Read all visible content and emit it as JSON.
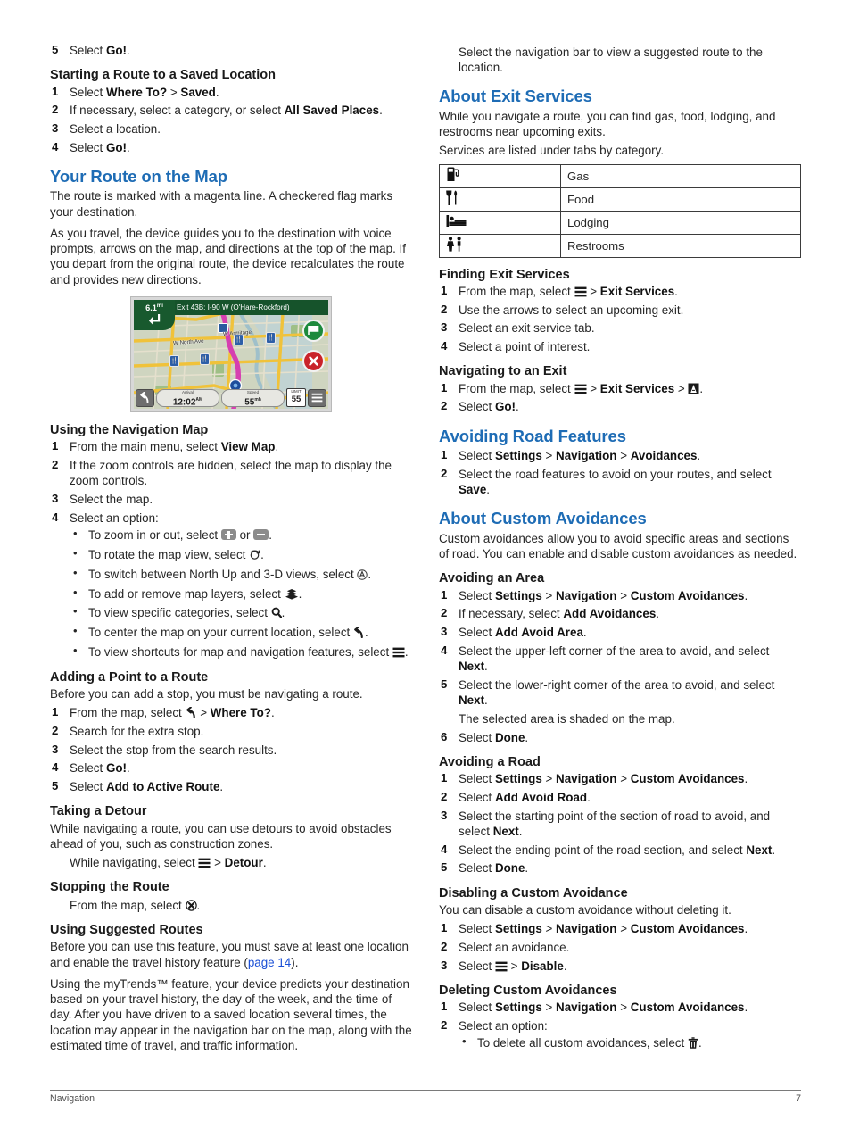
{
  "document": {
    "footer_section": "Navigation",
    "page_number": "7",
    "heading_color": "#1e6cb5",
    "link_color": "#1a4fd6"
  },
  "left_column": {
    "orphan_step": {
      "number": "5",
      "text_prefix": "Select ",
      "bold": "Go!",
      "text_suffix": "."
    },
    "starting_route_saved": {
      "heading": "Starting a Route to a Saved Location",
      "steps": [
        {
          "pre": "Select ",
          "b1": "Where To?",
          "mid": " > ",
          "b2": "Saved",
          "post": "."
        },
        {
          "pre": "If necessary, select a category, or select ",
          "b1": "All Saved Places",
          "post": "."
        },
        {
          "pre": "Select a location.",
          "post": ""
        },
        {
          "pre": "Select ",
          "b1": "Go!",
          "post": "."
        }
      ]
    },
    "your_route": {
      "heading": "Your Route on the Map",
      "para1": "The route is marked with a magenta line. A checkered flag marks your destination.",
      "para2": "As you travel, the device guides you to the destination with voice prompts, arrows on the map, and directions at the top of the map. If you depart from the original route, the device recalculates the route and provides new directions."
    },
    "map_figure": {
      "turn_distance": "6.1",
      "turn_distance_unit": "mi",
      "turn_arrow_icon": "turn-left-arrow-icon",
      "banner_text": "Exit 43B: I-90 W (O'Hare-Rockford)",
      "back_icon": "back-arrow-icon",
      "arrival_label": "Arrival",
      "arrival_value": "12:02",
      "arrival_suffix": "AM",
      "speed_label": "Speed",
      "speed_value": "55",
      "speed_suffix": "mh",
      "speed_limit_label": "LIMIT",
      "speed_limit_value": "55",
      "menu_icon": "hamburger-menu-icon",
      "go_button_icon": "go-flag-icon",
      "stop_button_icon": "stop-x-icon",
      "street_labels": [
        "W North Ave",
        "W Armitage",
        "I-90"
      ],
      "poi_icon": "restaurant-fork-knife-icon"
    },
    "using_nav_map": {
      "heading": "Using the Navigation Map",
      "steps": [
        {
          "pre": "From the main menu, select ",
          "b1": "View Map",
          "post": "."
        },
        {
          "pre": "If the zoom controls are hidden, select the map to display the zoom controls.",
          "post": ""
        },
        {
          "pre": "Select the map.",
          "post": ""
        },
        {
          "pre": "Select an option:",
          "post": ""
        }
      ],
      "options": [
        {
          "pre": "To zoom in or out, select ",
          "icon1": "zoom-in-plus-icon",
          "mid": " or ",
          "icon2": "zoom-out-minus-icon",
          "post": "."
        },
        {
          "pre": "To rotate the map view, select ",
          "icon1": "rotate-map-icon",
          "post": "."
        },
        {
          "pre": "To switch between North Up and 3-D views, select ",
          "icon1": "north-up-3d-view-icon",
          "post": "."
        },
        {
          "pre": "To add or remove map layers, select ",
          "icon1": "map-layers-icon",
          "post": "."
        },
        {
          "pre": "To view specific categories, select ",
          "icon1": "search-magnifier-icon",
          "post": "."
        },
        {
          "pre": "To center the map on your current location, select ",
          "icon1": "back-arrow-icon",
          "post": "."
        },
        {
          "pre": "To view shortcuts for map and navigation features, select ",
          "icon1": "hamburger-menu-icon",
          "post": "."
        }
      ]
    },
    "adding_point": {
      "heading": "Adding a Point to a Route",
      "intro": "Before you can add a stop, you must be navigating a route.",
      "steps": [
        {
          "pre": "From the map, select ",
          "icon1": "back-arrow-icon",
          "mid": " > ",
          "b2": "Where To?",
          "post": "."
        },
        {
          "pre": "Search for the extra stop.",
          "post": ""
        },
        {
          "pre": "Select the stop from the search results.",
          "post": ""
        },
        {
          "pre": "Select ",
          "b1": "Go!",
          "post": "."
        },
        {
          "pre": "Select ",
          "b1": "Add to Active Route",
          "post": "."
        }
      ]
    },
    "taking_detour": {
      "heading": "Taking a Detour",
      "intro": "While navigating a route, you can use detours to avoid obstacles ahead of you, such as construction zones.",
      "note_pre": "While navigating, select ",
      "note_icon": "hamburger-menu-icon",
      "note_mid": " > ",
      "note_bold": "Detour",
      "note_post": "."
    },
    "stopping_route": {
      "heading": "Stopping the Route",
      "note_pre": "From the map, select ",
      "note_icon": "stop-x-icon",
      "note_post": "."
    },
    "suggested_routes": {
      "heading": "Using Suggested Routes",
      "para1_pre": "Before you can use this feature, you must save at least one location and enable the travel history feature (",
      "para1_link": "page 14",
      "para1_post": ").",
      "para2": "Using the myTrends™ feature, your device predicts your destination based on your travel history, the day of the week, and the time of day. After you have driven to a saved location several times, the location may appear in the navigation bar on the map, along with the estimated time of travel, and traffic information."
    }
  },
  "right_column": {
    "top_note": "Select the navigation bar to view a suggested route to the location.",
    "about_exit_services": {
      "heading": "About Exit Services",
      "para1": "While you navigate a route, you can find gas, food, lodging, and restrooms near upcoming exits.",
      "para2": "Services are listed under tabs by category.",
      "table": [
        {
          "icon": "gas-pump-icon",
          "label": "Gas"
        },
        {
          "icon": "fork-knife-icon",
          "label": "Food"
        },
        {
          "icon": "bed-lodging-icon",
          "label": "Lodging"
        },
        {
          "icon": "restrooms-icon",
          "label": "Restrooms"
        }
      ]
    },
    "finding_exit_services": {
      "heading": "Finding Exit Services",
      "steps": [
        {
          "pre": "From the map, select ",
          "icon1": "hamburger-menu-icon",
          "mid": " > ",
          "b2": "Exit Services",
          "post": "."
        },
        {
          "pre": "Use the arrows to select an upcoming exit.",
          "post": ""
        },
        {
          "pre": "Select an exit service tab.",
          "post": ""
        },
        {
          "pre": "Select a point of interest.",
          "post": ""
        }
      ]
    },
    "navigating_to_exit": {
      "heading": "Navigating to an Exit",
      "steps": [
        {
          "pre": "From the map, select ",
          "icon1": "hamburger-menu-icon",
          "mid": " > ",
          "b2": "Exit Services",
          "mid2": " > ",
          "icon2": "navigate-route-icon",
          "post": "."
        },
        {
          "pre": "Select ",
          "b1": "Go!",
          "post": "."
        }
      ]
    },
    "avoiding_road_features": {
      "heading": "Avoiding Road Features",
      "steps": [
        {
          "pre": "Select ",
          "b1": "Settings",
          "mid": " > ",
          "b2": "Navigation",
          "mid2": " > ",
          "b3": "Avoidances",
          "post": "."
        },
        {
          "pre": "Select the road features to avoid on your routes, and select ",
          "b1": "Save",
          "post": "."
        }
      ]
    },
    "about_custom_avoidances": {
      "heading": "About Custom Avoidances",
      "para1": "Custom avoidances allow you to avoid specific areas and sections of road. You can enable and disable custom avoidances as needed."
    },
    "avoiding_area": {
      "heading": "Avoiding an Area",
      "steps": [
        {
          "pre": "Select ",
          "b1": "Settings",
          "mid": " > ",
          "b2": "Navigation",
          "mid2": " > ",
          "b3": "Custom Avoidances",
          "post": "."
        },
        {
          "pre": "If necessary, select ",
          "b1": "Add Avoidances",
          "post": "."
        },
        {
          "pre": "Select ",
          "b1": "Add Avoid Area",
          "post": "."
        },
        {
          "pre": "Select the upper-left corner of the area to avoid, and select ",
          "b1": "Next",
          "post": "."
        },
        {
          "pre": "Select the lower-right corner of the area to avoid, and select ",
          "b1": "Next",
          "post": "."
        }
      ],
      "note_after_step5": "The selected area is shaded on the map.",
      "final_step": {
        "pre": "Select ",
        "b1": "Done",
        "post": "."
      }
    },
    "avoiding_road": {
      "heading": "Avoiding a Road",
      "steps": [
        {
          "pre": "Select ",
          "b1": "Settings",
          "mid": " > ",
          "b2": "Navigation",
          "mid2": " > ",
          "b3": "Custom Avoidances",
          "post": "."
        },
        {
          "pre": "Select ",
          "b1": "Add Avoid Road",
          "post": "."
        },
        {
          "pre": "Select the starting point of the section of road to avoid, and select ",
          "b1": "Next",
          "post": "."
        },
        {
          "pre": "Select the ending point of the road section, and select ",
          "b1": "Next",
          "post": "."
        },
        {
          "pre": "Select ",
          "b1": "Done",
          "post": "."
        }
      ]
    },
    "disabling_custom_avoidance": {
      "heading": "Disabling a Custom Avoidance",
      "intro": "You can disable a custom avoidance without deleting it.",
      "steps": [
        {
          "pre": "Select ",
          "b1": "Settings",
          "mid": " > ",
          "b2": "Navigation",
          "mid2": " > ",
          "b3": "Custom Avoidances",
          "post": "."
        },
        {
          "pre": "Select an avoidance.",
          "post": ""
        },
        {
          "pre": "Select ",
          "icon1": "hamburger-menu-icon",
          "mid": " > ",
          "b2": "Disable",
          "post": "."
        }
      ]
    },
    "deleting_custom_avoidances": {
      "heading": "Deleting Custom Avoidances",
      "steps": [
        {
          "pre": "Select ",
          "b1": "Settings",
          "mid": " > ",
          "b2": "Navigation",
          "mid2": " > ",
          "b3": "Custom Avoidances",
          "post": "."
        },
        {
          "pre": "Select an option:",
          "post": ""
        }
      ],
      "options": [
        {
          "pre": "To delete all custom avoidances, select ",
          "icon1": "trash-can-icon",
          "post": "."
        }
      ]
    }
  }
}
